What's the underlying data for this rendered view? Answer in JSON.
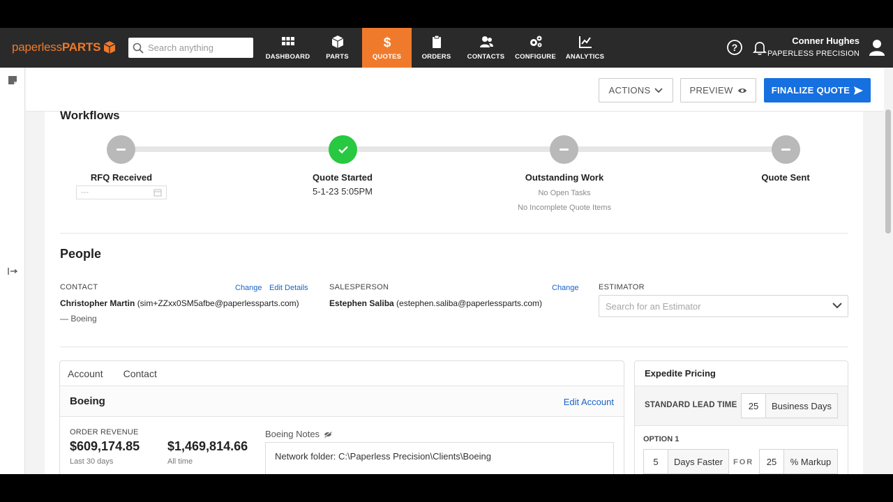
{
  "brand": {
    "part1": "paperless",
    "part2": "PARTS"
  },
  "search": {
    "placeholder": "Search anything"
  },
  "nav": {
    "items": [
      {
        "label": "DASHBOARD"
      },
      {
        "label": "PARTS"
      },
      {
        "label": "QUOTES"
      },
      {
        "label": "ORDERS"
      },
      {
        "label": "CONTACTS"
      },
      {
        "label": "CONFIGURE"
      },
      {
        "label": "ANALYTICS"
      }
    ],
    "active": "QUOTES"
  },
  "user": {
    "name": "Conner Hughes",
    "company": "PAPERLESS PRECISION"
  },
  "toolbar": {
    "actions_label": "ACTIONS",
    "preview_label": "PREVIEW",
    "finalize_label": "FINALIZE QUOTE"
  },
  "workflows": {
    "title": "Workflows",
    "steps": [
      {
        "label": "RFQ Received",
        "status": "pending",
        "date_placeholder": "---"
      },
      {
        "label": "Quote Started",
        "status": "complete",
        "detail": "5-1-23 5:05PM"
      },
      {
        "label": "Outstanding Work",
        "status": "pending",
        "note1": "No Open Tasks",
        "note2": "No Incomplete Quote Items"
      },
      {
        "label": "Quote Sent",
        "status": "pending"
      }
    ]
  },
  "people": {
    "title": "People",
    "contact": {
      "label": "CONTACT",
      "change": "Change",
      "edit": "Edit Details",
      "name": "Christopher Martin",
      "email": "(sim+ZZxx0SM5afbe@paperlessparts.com)",
      "company": "— Boeing"
    },
    "salesperson": {
      "label": "SALESPERSON",
      "change": "Change",
      "name": "Estephen Saliba",
      "email": "(estephen.saliba@paperlessparts.com)"
    },
    "estimator": {
      "label": "ESTIMATOR",
      "placeholder": "Search for an Estimator"
    }
  },
  "account": {
    "tabs": [
      "Account",
      "Contact"
    ],
    "name": "Boeing",
    "edit_label": "Edit Account",
    "order_revenue_label": "ORDER REVENUE",
    "revenue_30": "$609,174.85",
    "revenue_30_label": "Last 30 days",
    "revenue_all": "$1,469,814.66",
    "revenue_all_label": "All time",
    "notes_label": "Boeing Notes",
    "notes_text": "Network folder: C:\\Paperless Precision\\Clients\\Boeing"
  },
  "expedite": {
    "title": "Expedite Pricing",
    "standard_label": "STANDARD LEAD TIME",
    "standard_value": "25",
    "standard_unit": "Business Days",
    "option_label": "OPTION 1",
    "option_days": "5",
    "option_days_unit": "Days Faster",
    "for_label": "FOR",
    "option_markup": "25",
    "option_markup_unit": "% Markup"
  },
  "colors": {
    "brand_orange": "#f07a2b",
    "primary_blue": "#1670e0",
    "complete_green": "#28c840",
    "nav_bg": "#2a2a2a"
  }
}
